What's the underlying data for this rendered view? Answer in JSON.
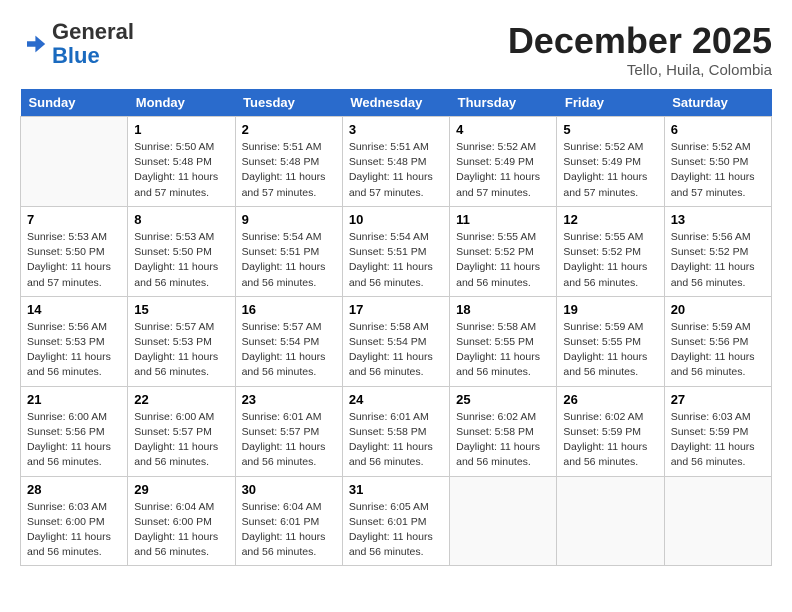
{
  "header": {
    "logo_general": "General",
    "logo_blue": "Blue",
    "month": "December 2025",
    "location": "Tello, Huila, Colombia"
  },
  "weekdays": [
    "Sunday",
    "Monday",
    "Tuesday",
    "Wednesday",
    "Thursday",
    "Friday",
    "Saturday"
  ],
  "weeks": [
    [
      {
        "day": "",
        "info": ""
      },
      {
        "day": "1",
        "info": "Sunrise: 5:50 AM\nSunset: 5:48 PM\nDaylight: 11 hours\nand 57 minutes."
      },
      {
        "day": "2",
        "info": "Sunrise: 5:51 AM\nSunset: 5:48 PM\nDaylight: 11 hours\nand 57 minutes."
      },
      {
        "day": "3",
        "info": "Sunrise: 5:51 AM\nSunset: 5:48 PM\nDaylight: 11 hours\nand 57 minutes."
      },
      {
        "day": "4",
        "info": "Sunrise: 5:52 AM\nSunset: 5:49 PM\nDaylight: 11 hours\nand 57 minutes."
      },
      {
        "day": "5",
        "info": "Sunrise: 5:52 AM\nSunset: 5:49 PM\nDaylight: 11 hours\nand 57 minutes."
      },
      {
        "day": "6",
        "info": "Sunrise: 5:52 AM\nSunset: 5:50 PM\nDaylight: 11 hours\nand 57 minutes."
      }
    ],
    [
      {
        "day": "7",
        "info": "Sunrise: 5:53 AM\nSunset: 5:50 PM\nDaylight: 11 hours\nand 57 minutes."
      },
      {
        "day": "8",
        "info": "Sunrise: 5:53 AM\nSunset: 5:50 PM\nDaylight: 11 hours\nand 56 minutes."
      },
      {
        "day": "9",
        "info": "Sunrise: 5:54 AM\nSunset: 5:51 PM\nDaylight: 11 hours\nand 56 minutes."
      },
      {
        "day": "10",
        "info": "Sunrise: 5:54 AM\nSunset: 5:51 PM\nDaylight: 11 hours\nand 56 minutes."
      },
      {
        "day": "11",
        "info": "Sunrise: 5:55 AM\nSunset: 5:52 PM\nDaylight: 11 hours\nand 56 minutes."
      },
      {
        "day": "12",
        "info": "Sunrise: 5:55 AM\nSunset: 5:52 PM\nDaylight: 11 hours\nand 56 minutes."
      },
      {
        "day": "13",
        "info": "Sunrise: 5:56 AM\nSunset: 5:52 PM\nDaylight: 11 hours\nand 56 minutes."
      }
    ],
    [
      {
        "day": "14",
        "info": "Sunrise: 5:56 AM\nSunset: 5:53 PM\nDaylight: 11 hours\nand 56 minutes."
      },
      {
        "day": "15",
        "info": "Sunrise: 5:57 AM\nSunset: 5:53 PM\nDaylight: 11 hours\nand 56 minutes."
      },
      {
        "day": "16",
        "info": "Sunrise: 5:57 AM\nSunset: 5:54 PM\nDaylight: 11 hours\nand 56 minutes."
      },
      {
        "day": "17",
        "info": "Sunrise: 5:58 AM\nSunset: 5:54 PM\nDaylight: 11 hours\nand 56 minutes."
      },
      {
        "day": "18",
        "info": "Sunrise: 5:58 AM\nSunset: 5:55 PM\nDaylight: 11 hours\nand 56 minutes."
      },
      {
        "day": "19",
        "info": "Sunrise: 5:59 AM\nSunset: 5:55 PM\nDaylight: 11 hours\nand 56 minutes."
      },
      {
        "day": "20",
        "info": "Sunrise: 5:59 AM\nSunset: 5:56 PM\nDaylight: 11 hours\nand 56 minutes."
      }
    ],
    [
      {
        "day": "21",
        "info": "Sunrise: 6:00 AM\nSunset: 5:56 PM\nDaylight: 11 hours\nand 56 minutes."
      },
      {
        "day": "22",
        "info": "Sunrise: 6:00 AM\nSunset: 5:57 PM\nDaylight: 11 hours\nand 56 minutes."
      },
      {
        "day": "23",
        "info": "Sunrise: 6:01 AM\nSunset: 5:57 PM\nDaylight: 11 hours\nand 56 minutes."
      },
      {
        "day": "24",
        "info": "Sunrise: 6:01 AM\nSunset: 5:58 PM\nDaylight: 11 hours\nand 56 minutes."
      },
      {
        "day": "25",
        "info": "Sunrise: 6:02 AM\nSunset: 5:58 PM\nDaylight: 11 hours\nand 56 minutes."
      },
      {
        "day": "26",
        "info": "Sunrise: 6:02 AM\nSunset: 5:59 PM\nDaylight: 11 hours\nand 56 minutes."
      },
      {
        "day": "27",
        "info": "Sunrise: 6:03 AM\nSunset: 5:59 PM\nDaylight: 11 hours\nand 56 minutes."
      }
    ],
    [
      {
        "day": "28",
        "info": "Sunrise: 6:03 AM\nSunset: 6:00 PM\nDaylight: 11 hours\nand 56 minutes."
      },
      {
        "day": "29",
        "info": "Sunrise: 6:04 AM\nSunset: 6:00 PM\nDaylight: 11 hours\nand 56 minutes."
      },
      {
        "day": "30",
        "info": "Sunrise: 6:04 AM\nSunset: 6:01 PM\nDaylight: 11 hours\nand 56 minutes."
      },
      {
        "day": "31",
        "info": "Sunrise: 6:05 AM\nSunset: 6:01 PM\nDaylight: 11 hours\nand 56 minutes."
      },
      {
        "day": "",
        "info": ""
      },
      {
        "day": "",
        "info": ""
      },
      {
        "day": "",
        "info": ""
      }
    ]
  ]
}
